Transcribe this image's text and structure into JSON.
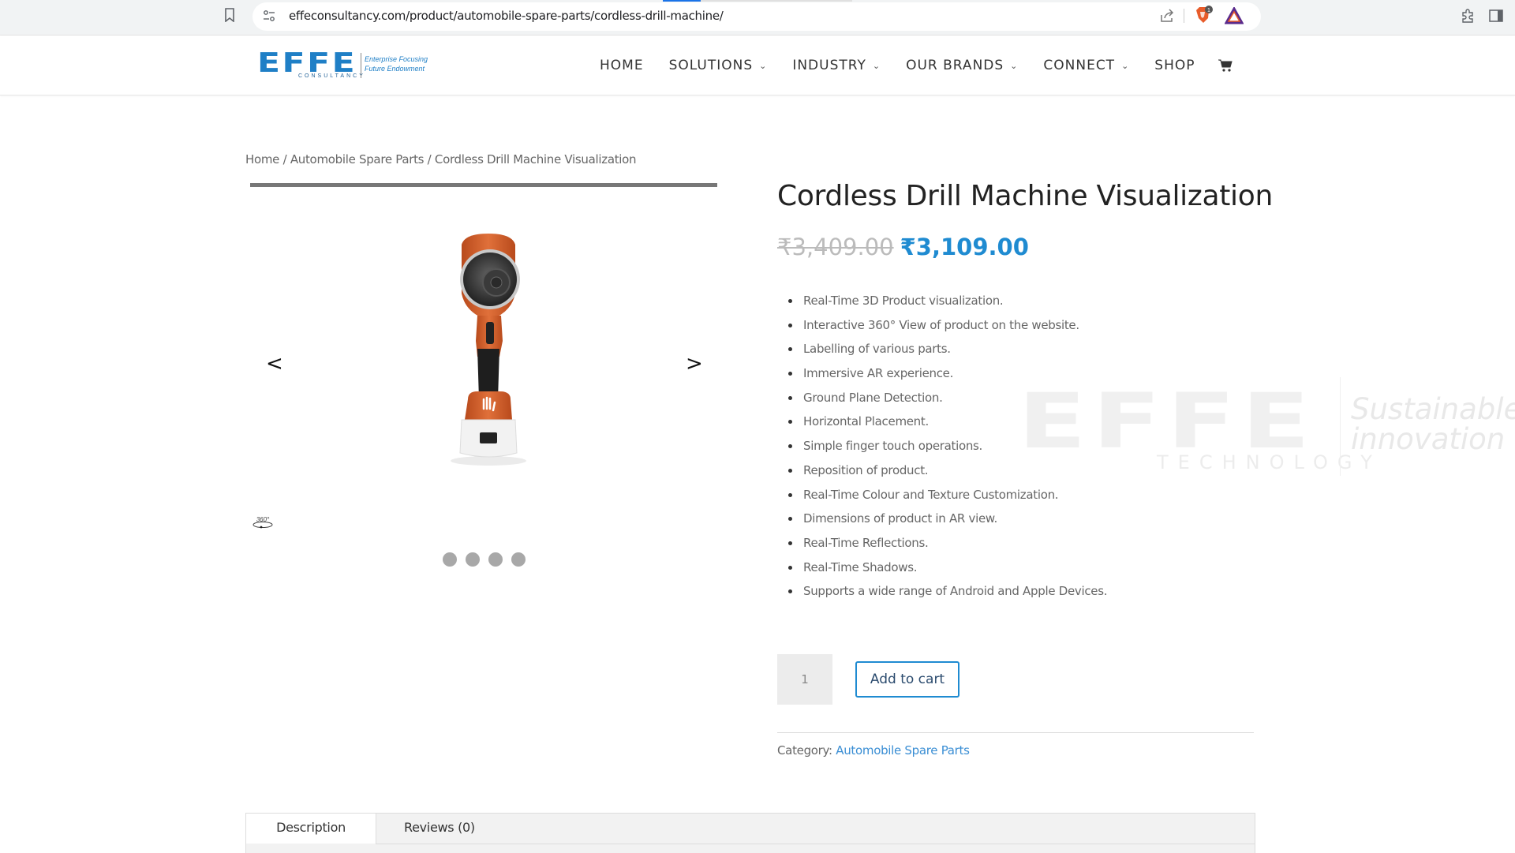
{
  "browser": {
    "url": "effeconsultancy.com/product/automobile-spare-parts/cordless-drill-machine/",
    "load_progress": 0.2,
    "brave_badge": "1",
    "icons": [
      "bookmark-icon",
      "tune-icon",
      "share-icon",
      "brave-shields-icon",
      "brave-rewards-icon",
      "extensions-icon",
      "side-panel-icon"
    ]
  },
  "header": {
    "logo": {
      "mark": "EFFE",
      "sub": "CONSULTANCY",
      "tagline_1": "Enterprise Focusing",
      "tagline_2": "Future Endowment"
    },
    "nav": [
      {
        "label": "HOME",
        "has_dropdown": false
      },
      {
        "label": "SOLUTIONS",
        "has_dropdown": true
      },
      {
        "label": "INDUSTRY",
        "has_dropdown": true
      },
      {
        "label": "OUR BRANDS",
        "has_dropdown": true
      },
      {
        "label": "CONNECT",
        "has_dropdown": true
      },
      {
        "label": "SHOP",
        "has_dropdown": false
      }
    ],
    "chevron": "⌄"
  },
  "breadcrumb": {
    "home": "Home",
    "sep": " / ",
    "category": "Automobile Spare Parts",
    "current": "Cordless Drill Machine Visualization"
  },
  "gallery": {
    "prev": "<",
    "next": ">",
    "slide_count": 4,
    "icon_360": "360°"
  },
  "product": {
    "title": "Cordless Drill Machine Visualization",
    "price_old": "₹3,409.00",
    "price_new": "₹3,109.00",
    "features": [
      "Real-Time 3D Product visualization.",
      "Interactive 360° View of product on the website.",
      "Labelling of various parts.",
      "Immersive AR experience.",
      "Ground Plane Detection.",
      "Horizontal Placement.",
      "Simple finger touch operations.",
      "Reposition of product.",
      "Real-Time Colour and Texture Customization.",
      "Dimensions of product in AR view.",
      "Real-Time Reflections.",
      "Real-Time Shadows.",
      "Supports a wide range of Android and Apple Devices."
    ],
    "quantity": "1",
    "add_to_cart": "Add to cart",
    "category_label": "Category:",
    "category_value": "Automobile Spare Parts"
  },
  "watermark": {
    "mark": "EFFE",
    "sub": "TECHNOLOGY",
    "tag_1": "Sustainable",
    "tag_2": "innovation"
  },
  "tabs": [
    {
      "label": "Description",
      "active": true
    },
    {
      "label": "Reviews (0)",
      "active": false
    }
  ],
  "colors": {
    "accent": "#1f8bd1",
    "logo_blue": "#1f7fc6",
    "drill_orange": "#d9622b"
  }
}
